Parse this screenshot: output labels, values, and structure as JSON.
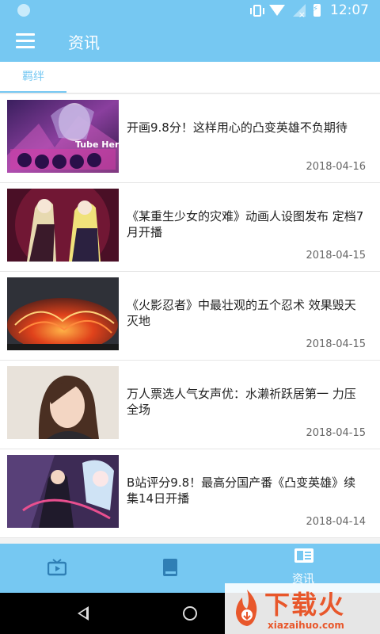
{
  "status_bar": {
    "time": "12:07"
  },
  "app_bar": {
    "title": "资讯",
    "menu_icon": "hamburger-menu-icon"
  },
  "tabs": [
    {
      "label": "羁绊"
    }
  ],
  "articles": [
    {
      "title": "开画9.8分！这样用心的凸变英雄不负期待",
      "date": "2018-04-16",
      "thumb_text": "Tube Hero"
    },
    {
      "title": "《某重生少女的灾难》动画人设图发布 定档7月开播",
      "date": "2018-04-15"
    },
    {
      "title": "《火影忍者》中最壮观的五个忍术 效果毁天灭地",
      "date": "2018-04-15"
    },
    {
      "title": "万人票选人气女声优：水濑祈跃居第一 力压全场",
      "date": "2018-04-15"
    },
    {
      "title": "B站评分9.8！最高分国产番《凸变英雄》续集14日开播",
      "date": "2018-04-14"
    }
  ],
  "bottom_nav": [
    {
      "label": "",
      "icon": "tv-icon"
    },
    {
      "label": "",
      "icon": "book-icon"
    },
    {
      "label": "资讯",
      "icon": "news-icon"
    }
  ],
  "watermark": {
    "text": "下载火",
    "site": "xiazaihuo.com"
  },
  "colors": {
    "primary": "#76c8f2",
    "background": "#f2f2f2",
    "watermark": "#e8572b"
  }
}
